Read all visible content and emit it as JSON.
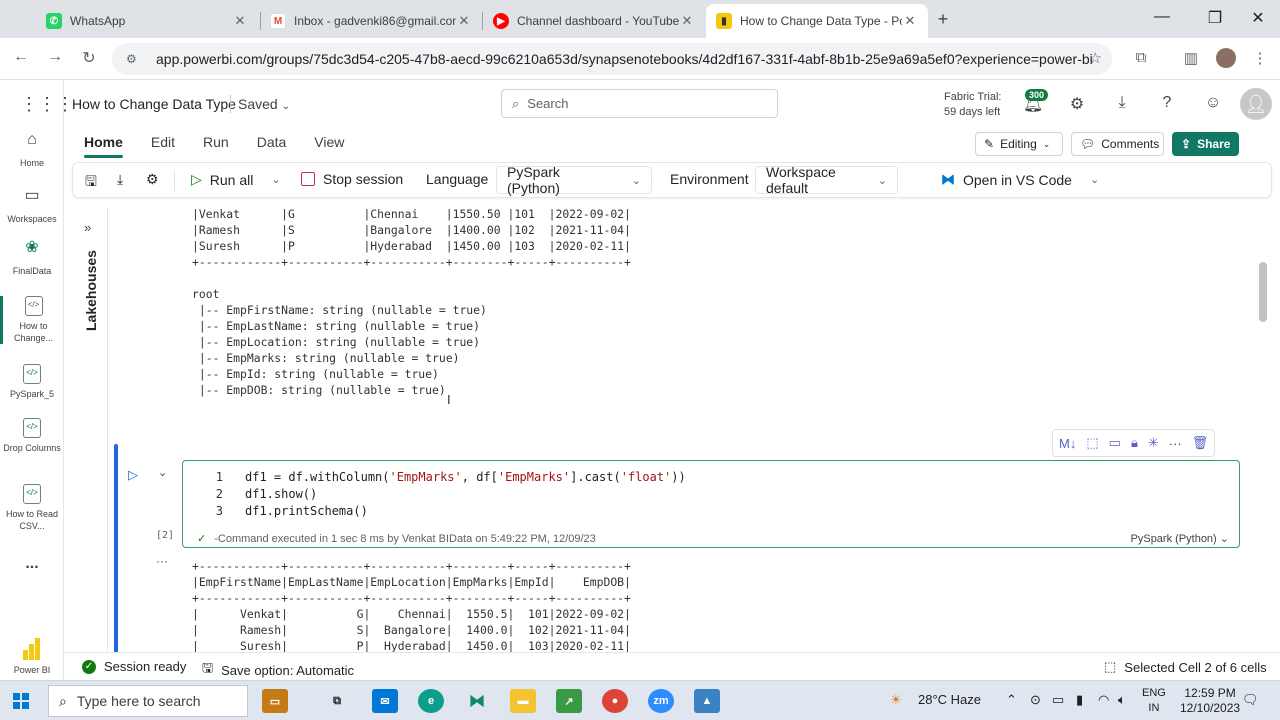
{
  "browser": {
    "tabs": [
      {
        "title": "WhatsApp",
        "icon": "whatsapp-icon",
        "color": "#25d366"
      },
      {
        "title": "Inbox - gadvenki86@gmail.com",
        "icon": "gmail-icon",
        "color": "#ea4335"
      },
      {
        "title": "Channel dashboard - YouTube",
        "icon": "youtube-icon",
        "color": "#ff0000"
      },
      {
        "title": "How to Change Data Type - Po",
        "icon": "powerbi-icon",
        "color": "#f2c811"
      }
    ],
    "url": "app.powerbi.com/groups/75dc3d54-c205-47b8-aecd-99c6210a653d/synapsenotebooks/4d2df167-331f-4abf-8b1b-25e9a69a5ef0?experience=power-bi"
  },
  "rail": {
    "items": [
      {
        "label": "Home",
        "icon": "home-icon"
      },
      {
        "label": "Workspaces",
        "icon": "workspaces-icon"
      },
      {
        "label": "FinalData",
        "icon": "finaldata-icon"
      },
      {
        "label": "How to Change...",
        "icon": "notebook-icon"
      },
      {
        "label": "PySpark_5",
        "icon": "notebook-icon"
      },
      {
        "label": "Drop Columns",
        "icon": "notebook-icon"
      },
      {
        "label": "How to Read CSV...",
        "icon": "notebook-icon"
      },
      {
        "label": "...",
        "icon": "more-icon"
      },
      {
        "label": "Power BI",
        "icon": "powerbi-icon"
      }
    ]
  },
  "header": {
    "title": "How to Change Data Type",
    "saved": "Saved",
    "search_placeholder": "Search",
    "trial_line1": "Fabric Trial:",
    "trial_line2": "59 days left",
    "notifications": "300"
  },
  "ribbon": {
    "tabs": [
      "Home",
      "Edit",
      "Run",
      "Data",
      "View"
    ],
    "editing": "Editing",
    "comments": "Comments",
    "share": "Share"
  },
  "toolbar": {
    "run_all": "Run all",
    "stop_session": "Stop session",
    "language_label": "Language",
    "language_value": "PySpark (Python)",
    "environment_label": "Environment",
    "environment_value": "Workspace default",
    "open_vscode": "Open in VS Code"
  },
  "lakehouses": "Lakehouses",
  "output_top": {
    "table_rows": [
      "|Venkat      |G          |Chennai    |1550.50 |101  |2022-09-02|",
      "|Ramesh      |S          |Bangalore  |1400.00 |102  |2021-11-04|",
      "|Suresh      |P          |Hyderabad  |1450.00 |103  |2020-02-11|",
      "+------------+-----------+-----------+--------+-----+----------+"
    ],
    "schema": [
      "root",
      " |-- EmpFirstName: string (nullable = true)",
      " |-- EmpLastName: string (nullable = true)",
      " |-- EmpLocation: string (nullable = true)",
      " |-- EmpMarks: string (nullable = true)",
      " |-- EmpId: string (nullable = true)",
      " |-- EmpDOB: string (nullable = true)"
    ]
  },
  "cell": {
    "lines": [
      {
        "num": "1",
        "pre": "df1 = df.withColumn(",
        "s1": "'EmpMarks'",
        "mid": ", df[",
        "s2": "'EmpMarks'",
        "mid2": "].cast(",
        "s3": "'float'",
        "post": "))"
      },
      {
        "num": "2",
        "text": "df1.show()"
      },
      {
        "num": "3",
        "text": "df1.printSchema()"
      }
    ],
    "exec_count": "[2]",
    "status": "-Command executed in 1 sec 8 ms by Venkat BIData on 5:49:22 PM, 12/09/23",
    "language": "PySpark (Python)"
  },
  "output_bottom": [
    "+------------+-----------+-----------+--------+-----+----------+",
    "|EmpFirstName|EmpLastName|EmpLocation|EmpMarks|EmpId|    EmpDOB|",
    "+------------+-----------+-----------+--------+-----+----------+",
    "|      Venkat|          G|    Chennai|  1550.5|  101|2022-09-02|",
    "|      Ramesh|          S|  Bangalore|  1400.0|  102|2021-11-04|",
    "|      Suresh|          P|  Hyderabad|  1450.0|  103|2020-02-11|"
  ],
  "statusbar": {
    "session": "Session ready",
    "save_option": "Save option: Automatic",
    "selected": "Selected Cell 2 of 6 cells"
  },
  "taskbar": {
    "search_placeholder": "Type here to search",
    "weather": "28°C  Haze",
    "lang1": "ENG",
    "lang2": "IN",
    "time": "12:59 PM",
    "date": "12/10/2023"
  }
}
